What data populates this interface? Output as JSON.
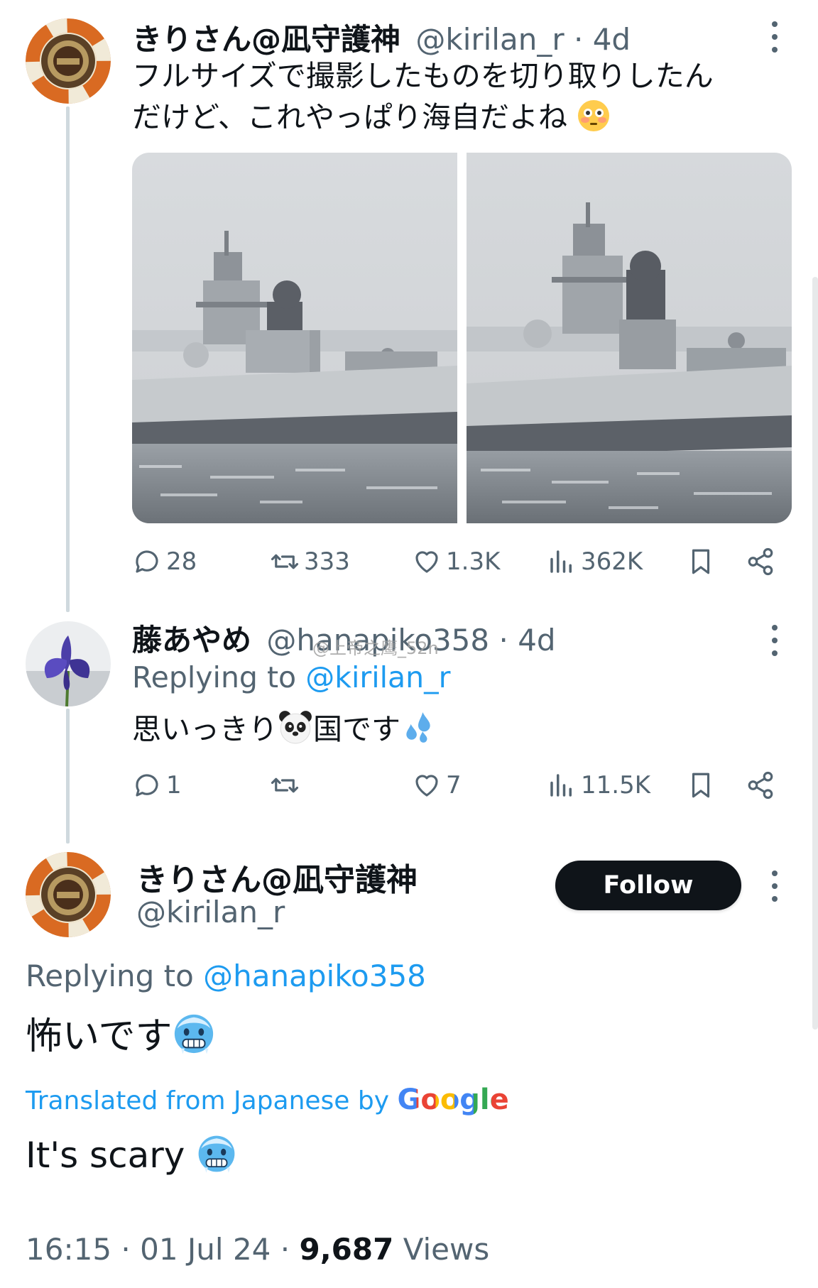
{
  "tweet1": {
    "display_name": "きりさん@凪守護神",
    "handle": "@kirilan_r",
    "separator": "·",
    "time": "4d",
    "text_line1": "フルサイズで撮影したものを切り取りしたん",
    "text_line2": "だけど、これやっぱり海自だよね",
    "emoji": "flushed-face",
    "stats": {
      "replies": "28",
      "retweets": "333",
      "likes": "1.3K",
      "views": "362K"
    }
  },
  "tweet2": {
    "display_name": "藤あやめ",
    "handle": "@hanapiko358",
    "separator": "·",
    "time": "4d",
    "replying_prefix": "Replying to",
    "replying_handle": "@kirilan_r",
    "text_before": "思いっきり",
    "text_after": "国です",
    "emoji_1": "panda-face",
    "emoji_2": "sweat-droplets",
    "stats": {
      "replies": "1",
      "retweets": "",
      "likes": "7",
      "views": "11.5K"
    }
  },
  "watermark": "@上帝之鹰_52n",
  "main_tweet": {
    "display_name": "きりさん@凪守護神",
    "handle": "@kirilan_r",
    "follow_label": "Follow",
    "replying_prefix": "Replying to",
    "replying_handle": "@hanapiko358",
    "text": "怖いです",
    "emoji": "cold-face",
    "translated_prefix": "Translated from Japanese by",
    "translated_brand": "Google",
    "translation": "It's scary",
    "time": "16:15",
    "date": "01 Jul 24",
    "views_count": "9,687",
    "views_label": "Views",
    "separator": "·"
  },
  "colors": {
    "accent": "#1d9bf0",
    "text_primary": "#0f1419",
    "text_muted": "#536471",
    "thread_line": "#cfd9de",
    "follow_bg": "#0f1419"
  }
}
